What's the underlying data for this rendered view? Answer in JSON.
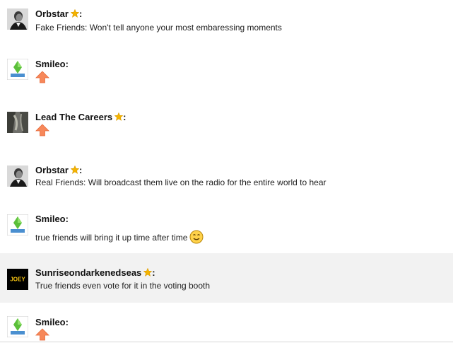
{
  "posts": [
    {
      "author": "Orbstar",
      "has_star": true,
      "colon": ":",
      "text": "Fake Friends: Won't tell anyone your most embaressing moments",
      "avatar": "man-portrait-icon"
    },
    {
      "author": "Smileo",
      "has_star": false,
      "colon": ":",
      "text": "",
      "avatar": "sims-logo-icon",
      "upvote": true
    },
    {
      "author": "Lead The Careers",
      "has_star": true,
      "colon": ":",
      "text": "",
      "avatar": "rock-texture-icon",
      "upvote": true
    },
    {
      "author": "Orbstar",
      "has_star": true,
      "colon": ":",
      "text": "Real Friends: Will broadcast them live on the radio for the entire world to hear",
      "avatar": "man-portrait-icon"
    },
    {
      "author": "Smileo",
      "has_star": false,
      "colon": ":",
      "text": "true friends will bring it up time after time",
      "avatar": "sims-logo-icon",
      "smiley": "grin-smiley-icon"
    },
    {
      "author": "Sunriseondarkenedseas",
      "has_star": true,
      "colon": ":",
      "text": "True friends even vote for it in the voting booth",
      "avatar": "joey-logo-icon",
      "avatar_text": "JOEY",
      "highlighted": true
    },
    {
      "author": "Smileo",
      "has_star": false,
      "colon": ":",
      "text": "",
      "avatar": "sims-logo-icon",
      "upvote": true
    }
  ],
  "colors": {
    "star": "#f5b400",
    "upvote": "#f7885a",
    "highlight": "#f2f2f2"
  }
}
